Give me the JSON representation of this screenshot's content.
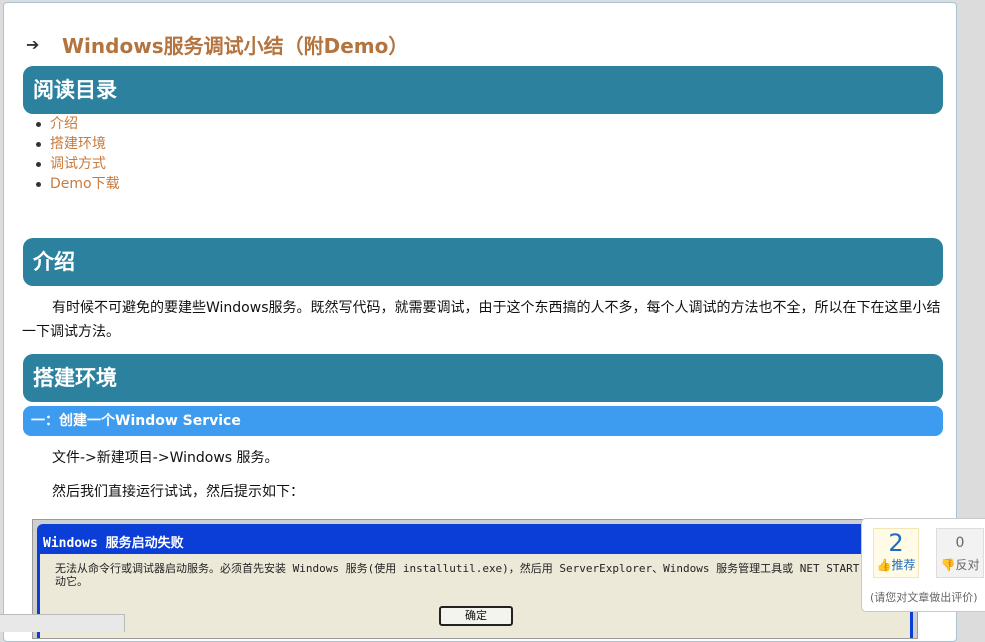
{
  "post": {
    "arrow": "➔",
    "title": "Windows服务调试小结（附Demo）"
  },
  "sections": {
    "toc_heading": "阅读目录",
    "intro_heading": "介绍",
    "env_heading": "搭建环境",
    "sub_heading": "一：创建一个Window Service"
  },
  "toc": [
    "介绍",
    "搭建环境",
    "调试方式",
    "Demo下载"
  ],
  "intro": {
    "text": "有时候不可避免的要建些Windows服务。既然写代码，就需要调试，由于这个东西搞的人不多，每个人调试的方法也不全，所以在下在这里小结一下调试方法。"
  },
  "env": {
    "step1": "文件->新建项目->Windows 服务。",
    "step2": "然后我们直接运行试试，然后提示如下："
  },
  "dialog": {
    "title": "Windows 服务启动失败",
    "message": "无法从命令行或调试器启动服务。必须首先安装 Windows 服务(使用 installutil.exe)，然后用 ServerExplorer、Windows 服务管理工具或 NET START 命令启动它。",
    "ok_label": "确定"
  },
  "vote": {
    "digg_count": "2",
    "digg_label": "推荐",
    "bury_count": "0",
    "bury_label": "反对",
    "tip": "(请您对文章做出评价)"
  },
  "colors": {
    "heading_bar": "#2c819e",
    "subheading_bar": "#3d9bf0",
    "title_text": "#b3743f",
    "link": "#c87a3c"
  }
}
